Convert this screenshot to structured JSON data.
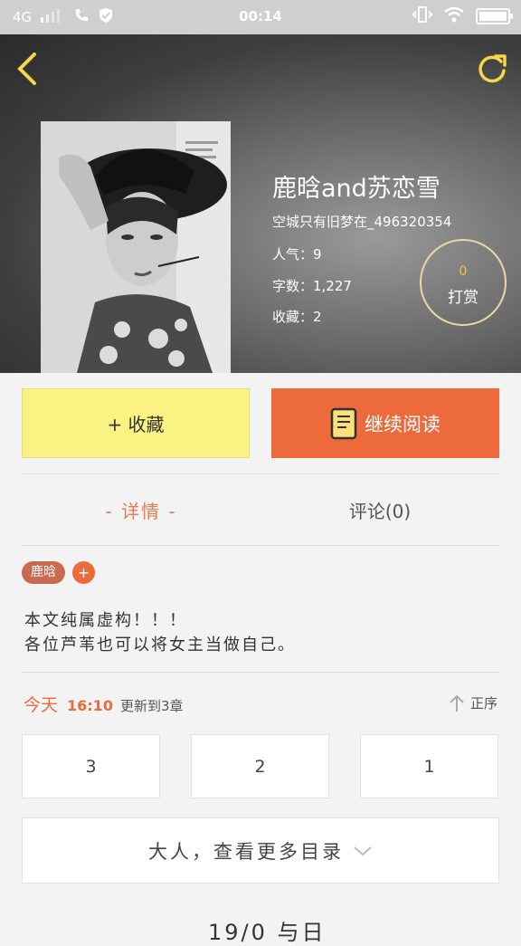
{
  "status_bar": {
    "network": "4G",
    "time": "00:14"
  },
  "book": {
    "title": "鹿晗and苏恋雪",
    "author": "空城只有旧梦在_496320354",
    "popularity": "人气：9",
    "word_count": "字数：1,227",
    "favorites": "收藏：2"
  },
  "tip": {
    "count": "0",
    "label": "打赏"
  },
  "actions": {
    "collect_label": "+ 收藏",
    "read_label": "继续阅读"
  },
  "tabs": {
    "detail": "- 详情 -",
    "comment": "评论(0)"
  },
  "tags": {
    "tag1": "鹿晗",
    "add": "+"
  },
  "description": {
    "line1": "本文纯属虚构！！！",
    "line2": "各位芦苇也可以将女主当做自己。"
  },
  "update": {
    "day": "今天",
    "time": "16:10",
    "text": "更新到3章",
    "sort_label": "正序"
  },
  "chapters": [
    "3",
    "2",
    "1"
  ],
  "more_catalog": "大人，查看更多目录",
  "cut_text": "19/0 与日",
  "colors": {
    "accent_orange": "#ec6a3b",
    "collect_yellow": "#fbf284"
  }
}
